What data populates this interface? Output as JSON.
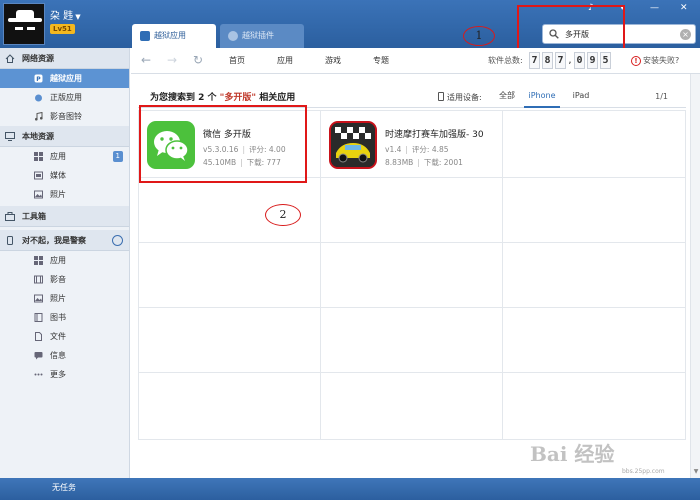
{
  "user": {
    "name": "朶 韪",
    "level": "Lv51"
  },
  "tabs": [
    {
      "label": "越狱应用"
    },
    {
      "label": "越狱插件"
    }
  ],
  "search": {
    "value": "多开版"
  },
  "annotations": {
    "one": "1",
    "two": "2"
  },
  "sidebar": {
    "sections": [
      {
        "title": "网络资源",
        "items": [
          {
            "label": "越狱应用"
          },
          {
            "label": "正版应用"
          },
          {
            "label": "影音图铃"
          }
        ]
      },
      {
        "title": "本地资源",
        "items": [
          {
            "label": "应用",
            "badge": "1"
          },
          {
            "label": "媒体"
          },
          {
            "label": "照片"
          }
        ]
      },
      {
        "title": "工具箱",
        "items": []
      },
      {
        "title": "对不起，我是警察",
        "items": [
          {
            "label": "应用"
          },
          {
            "label": "影音"
          },
          {
            "label": "照片"
          },
          {
            "label": "图书"
          },
          {
            "label": "文件"
          },
          {
            "label": "信息"
          },
          {
            "label": "更多"
          }
        ]
      }
    ]
  },
  "status": {
    "text": "无任务"
  },
  "toolbar": {
    "links": [
      "首页",
      "应用",
      "游戏",
      "专题"
    ],
    "counter_label": "软件总数:",
    "counter_digits": [
      "7",
      "8",
      "7",
      "0",
      "9",
      "5"
    ],
    "install_fail": "安装失败?"
  },
  "results": {
    "prefix": "为您搜索到 2 个",
    "keyword": "\"多开版\"",
    "suffix": "相关应用",
    "device_label": "适用设备:",
    "device_tabs": [
      "全部",
      "iPhone",
      "iPad"
    ],
    "page": "1/1"
  },
  "apps": [
    {
      "name": "微信 多开版",
      "version": "v5.3.0.16",
      "rating": "评分: 4.00",
      "size": "45.10MB",
      "downloads": "下载: 777"
    },
    {
      "name": "时速摩打赛车加强版- 30",
      "version": "v1.4",
      "rating": "评分: 4.85",
      "size": "8.83MB",
      "downloads": "下载: 2001"
    }
  ],
  "watermark": {
    "big": "Bai 经验",
    "small": "bbs.25pp.com"
  },
  "colors": {
    "accent": "#2f6db5",
    "highlight": "#e01818",
    "keyword": "#c0392b",
    "wechat": "#4cc13c"
  }
}
